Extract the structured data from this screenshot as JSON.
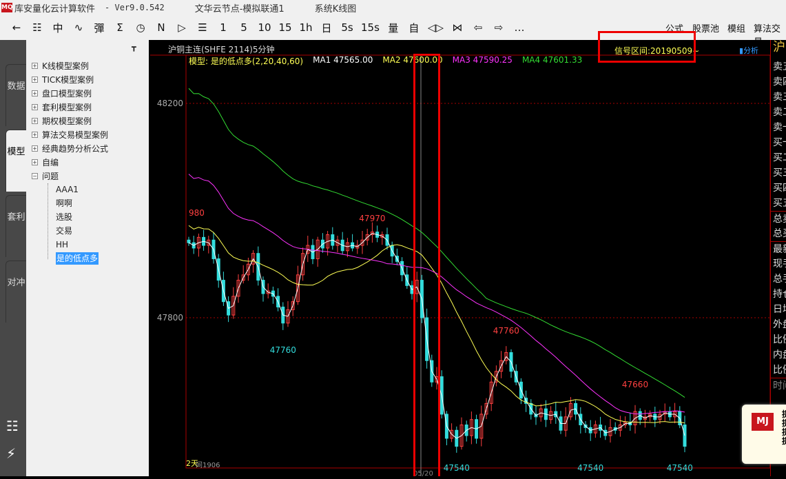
{
  "titlebar": {
    "app": "库安量化云计算软件",
    "version": "-  Ver9.0.542",
    "node": "文华云节点-模拟联通1",
    "view": "系统K线图",
    "logo": "MQ"
  },
  "toolbar": {
    "items": [
      "←",
      "☷",
      "中",
      "∿",
      "彈",
      "Σ",
      "◷",
      "N",
      "▷",
      "☰",
      "1",
      "5",
      "10",
      "15",
      "1h",
      "日",
      "5s",
      "15s",
      "量",
      "自",
      "◁▷",
      "⋈",
      "⇦",
      "⇨",
      "…"
    ],
    "right": [
      "公式",
      "股票池",
      "模组",
      "算法交易"
    ]
  },
  "leftbar": {
    "tabs": [
      "数据",
      "模型",
      "套利",
      "对冲"
    ]
  },
  "tree": {
    "items": [
      {
        "label": "K线模型案例",
        "sign": "+"
      },
      {
        "label": "TICK模型案例",
        "sign": "+"
      },
      {
        "label": "盘口模型案例",
        "sign": "+"
      },
      {
        "label": "套利模型案例",
        "sign": "+"
      },
      {
        "label": "期权模型案例",
        "sign": "+"
      },
      {
        "label": "算法交易模型案例",
        "sign": "+"
      },
      {
        "label": "经典趋势分析公式",
        "sign": "+"
      },
      {
        "label": "自编",
        "sign": "+"
      },
      {
        "label": "问题",
        "sign": "−"
      }
    ],
    "children": [
      "AAA1",
      "啊啊",
      "选股",
      "交易",
      "HH",
      "是的低点多"
    ],
    "pin": "📌"
  },
  "chart": {
    "symbol": "沪铜主连(SHFE 2114)5分钟",
    "model": "模型: 是的低点多(2,20,40,60)",
    "ma1": "MA1 47565.00",
    "ma2": "MA2 47600.00",
    "ma3": "MA3 47590.25",
    "ma4": "MA4 47601.33",
    "signal": "信号区间:20190509~",
    "analysis": "分析",
    "footer": "2天",
    "footer2": "间1906",
    "date": "05/20",
    "colors": {
      "up": "#ff4040",
      "down": "#33dddd",
      "ma1": "#ffffff",
      "ma2": "#ffff55",
      "ma3": "#ff33ff",
      "ma4": "#33dd33"
    }
  },
  "chart_data": {
    "type": "candlestick",
    "ylim": [
      47500,
      48300
    ],
    "yticks": [
      48200,
      47800
    ],
    "closes": [
      47940,
      47930,
      47950,
      47935,
      47945,
      47910,
      47870,
      47830,
      47805,
      47840,
      47870,
      47880,
      47900,
      47920,
      47870,
      47845,
      47850,
      47840,
      47820,
      47790,
      47815,
      47830,
      47880,
      47920,
      47935,
      47910,
      47945,
      47930,
      47955,
      47935,
      47945,
      47925,
      47940,
      47930,
      47935,
      47945,
      47955,
      47960,
      47950,
      47955,
      47935,
      47915,
      47905,
      47880,
      47860,
      47845,
      47870,
      47800,
      47720,
      47680,
      47690,
      47620,
      47575,
      47590,
      47560,
      47600,
      47580,
      47610,
      47575,
      47620,
      47640,
      47680,
      47700,
      47720,
      47735,
      47700,
      47680,
      47650,
      47640,
      47620,
      47615,
      47630,
      47610,
      47625,
      47615,
      47590,
      47615,
      47640,
      47620,
      47600,
      47595,
      47585,
      47600,
      47590,
      47580,
      47595,
      47590,
      47600,
      47605,
      47600,
      47625,
      47610,
      47615,
      47620,
      47610,
      47620,
      47625,
      47615,
      47625,
      47600,
      47560
    ],
    "annotations": [
      {
        "bar": 0,
        "price": 47980,
        "text": "980",
        "color": "#ff4040",
        "pos": "above"
      },
      {
        "bar": 37,
        "price": 47970,
        "text": "47970",
        "color": "#ff4040",
        "pos": "above"
      },
      {
        "bar": 19,
        "price": 47760,
        "text": "47760",
        "color": "#33dddd",
        "pos": "below"
      },
      {
        "bar": 64,
        "price": 47760,
        "text": "47760",
        "color": "#ff4040",
        "pos": "above"
      },
      {
        "bar": 90,
        "price": 47660,
        "text": "47660",
        "color": "#ff4040",
        "pos": "above"
      },
      {
        "bar": 54,
        "price": 47540,
        "text": "47540",
        "color": "#33dddd",
        "pos": "below"
      },
      {
        "bar": 81,
        "price": 47540,
        "text": "47540",
        "color": "#33dddd",
        "pos": "below"
      },
      {
        "bar": 99,
        "price": 47540,
        "text": "47540",
        "color": "#33dddd",
        "pos": "below"
      }
    ],
    "ma_periods": [
      2,
      20,
      40,
      60
    ]
  },
  "right_panel": {
    "title": "沪",
    "rows": [
      "卖五",
      "卖四",
      "卖三",
      "卖二",
      "卖一",
      "买一",
      "买二",
      "买三",
      "买四",
      "买五",
      "总卖",
      "总买",
      "最新",
      "现手",
      "总手",
      "持仓",
      "日增",
      "外盘",
      "比例",
      "内盘",
      "比例",
      "时间"
    ]
  },
  "popup": {
    "logo": "MJ",
    "lines": [
      "提",
      "提",
      "提",
      "提"
    ]
  }
}
